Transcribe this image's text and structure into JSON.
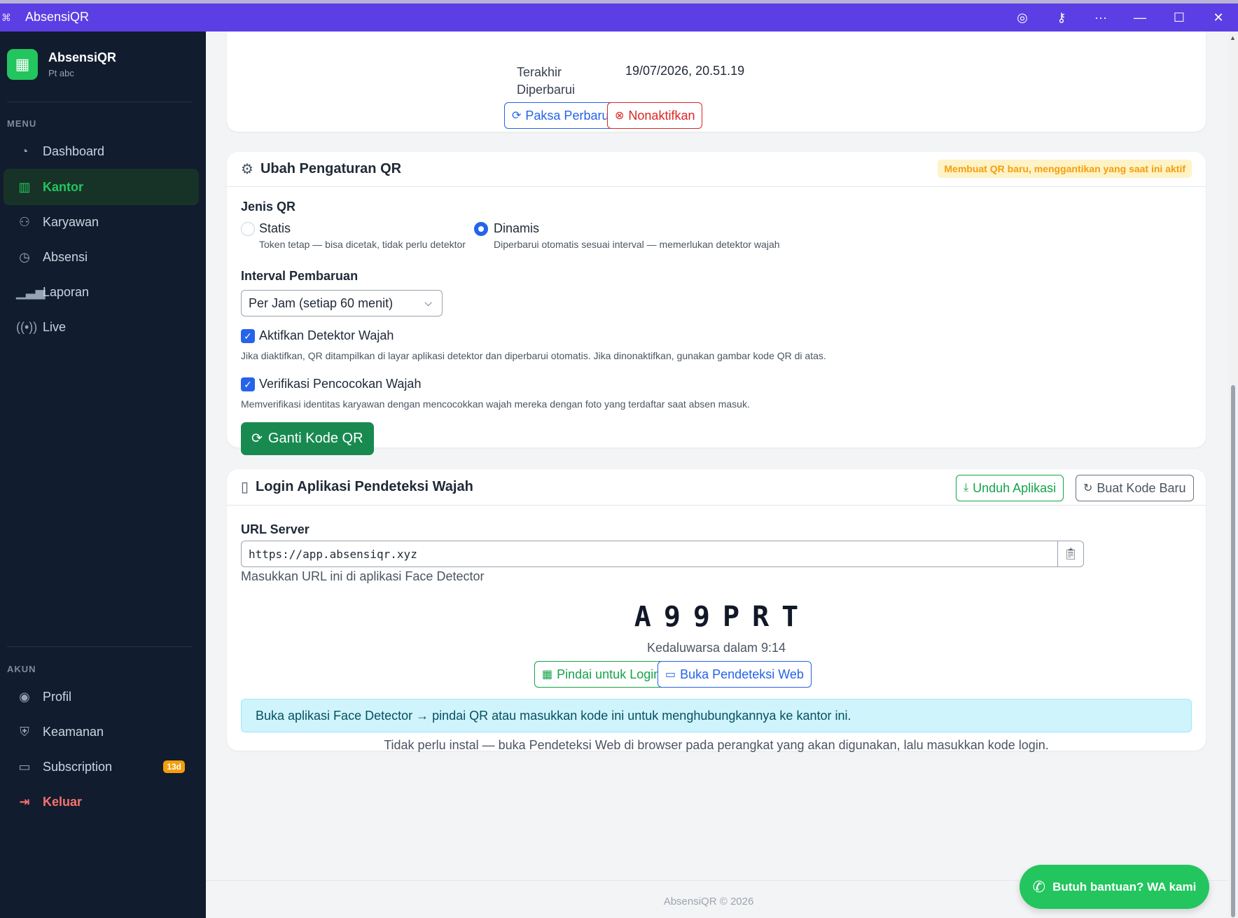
{
  "window": {
    "title": "AbsensiQR",
    "controls": [
      "location-icon",
      "key-icon",
      "more-icon",
      "minimize-icon",
      "maximize-icon",
      "close-icon"
    ]
  },
  "sidebar": {
    "brand_name": "AbsensiQR",
    "brand_sub": "Pt abc",
    "menu_label": "MENU",
    "account_label": "AKUN",
    "menu_items": [
      {
        "label": "Dashboard",
        "icon": "gauge-icon"
      },
      {
        "label": "Kantor",
        "icon": "building-icon",
        "active": true
      },
      {
        "label": "Karyawan",
        "icon": "users-icon"
      },
      {
        "label": "Absensi",
        "icon": "clock-icon"
      },
      {
        "label": "Laporan",
        "icon": "bar-chart-icon"
      },
      {
        "label": "Live",
        "icon": "broadcast-icon"
      }
    ],
    "account_items": [
      {
        "label": "Profil",
        "icon": "user-circle-icon"
      },
      {
        "label": "Keamanan",
        "icon": "shield-icon"
      },
      {
        "label": "Subscription",
        "icon": "credit-card-icon",
        "badge": "13d"
      },
      {
        "label": "Keluar",
        "icon": "logout-icon"
      }
    ]
  },
  "qr_status": {
    "last_updated_label": "Terakhir Diperbarui",
    "last_updated_value": "19/07/2026, 20.51.19",
    "force_refresh_label": "Paksa Perbarui",
    "deactivate_label": "Nonaktifkan"
  },
  "qr_settings": {
    "title": "Ubah Pengaturan QR",
    "warning_badge": "Membuat QR baru, menggantikan yang saat ini aktif",
    "type_label": "Jenis QR",
    "types": [
      {
        "label": "Statis",
        "desc": "Token tetap — bisa dicetak, tidak perlu detektor",
        "selected": false
      },
      {
        "label": "Dinamis",
        "desc": "Diperbarui otomatis sesuai interval — memerlukan detektor wajah",
        "selected": true
      }
    ],
    "interval_label": "Interval Pembaruan",
    "interval_value": "Per Jam (setiap 60 menit)",
    "face_detector_label": "Aktifkan Detektor Wajah",
    "face_detector_desc": "Jika diaktifkan, QR ditampilkan di layar aplikasi detektor dan diperbarui otomatis. Jika dinonaktifkan, gunakan gambar kode QR di atas.",
    "face_detector_checked": true,
    "face_match_label": "Verifikasi Pencocokan Wajah",
    "face_match_desc": "Memverifikasi identitas karyawan dengan mencocokkan wajah mereka dengan foto yang terdaftar saat absen masuk.",
    "face_match_checked": true,
    "submit_label": "Ganti Kode QR"
  },
  "detector_login": {
    "title": "Login Aplikasi Pendeteksi Wajah",
    "download_label": "Unduh Aplikasi",
    "new_code_label": "Buat Kode Baru",
    "url_label": "URL Server",
    "url_value": "https://app.absensiqr.xyz",
    "url_help": "Masukkan URL ini di aplikasi Face Detector",
    "code": "A99PRT",
    "expiry": "Kedaluwarsa dalam 9:14",
    "scan_label": "Pindai untuk Login",
    "web_label": "Buka Pendeteksi Web",
    "info": "Buka aplikasi Face Detector → pindai QR atau masukkan kode ini untuk menghubungkannya ke kantor ini.",
    "note": "Tidak perlu instal — buka Pendeteksi Web di browser pada perangkat yang akan digunakan, lalu masukkan kode login."
  },
  "footer": "AbsensiQR © 2026",
  "help_button": "Butuh bantuan? WA kami",
  "colors": {
    "titlebar": "#5b3fe4",
    "sidebar": "#111c2e",
    "accent_green": "#22c55e",
    "primary_blue": "#2563eb",
    "danger_red": "#dc2626",
    "submit_green": "#188a50"
  }
}
